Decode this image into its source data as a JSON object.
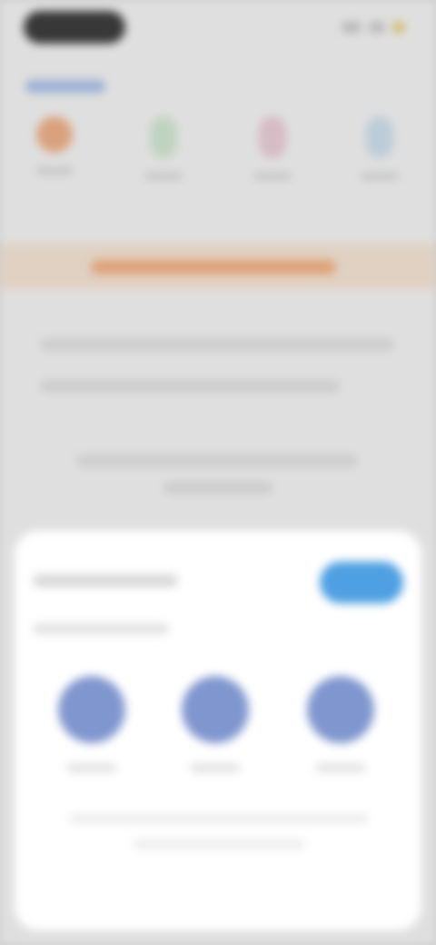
{
  "colors": {
    "background": "#e9e9e9",
    "sheet_background": "#ffffff",
    "accent_button": "#4fa0e2",
    "share_icon": "#8096cf",
    "promo_band": "#ead9c9",
    "promo_accent": "#e8a77a",
    "status_pill": "#333333"
  },
  "status_bar": {
    "icons": [
      "signal-icon",
      "wifi-icon",
      "battery-icon"
    ]
  },
  "categories": [
    {
      "icon": "category-icon-orange"
    },
    {
      "icon": "category-icon-green"
    },
    {
      "icon": "category-icon-pink"
    },
    {
      "icon": "category-icon-blue"
    }
  ],
  "sheet": {
    "title": "",
    "subtitle": "",
    "action_button_label": "",
    "targets": [
      {
        "icon": "share-target-icon",
        "label": ""
      },
      {
        "icon": "share-target-icon",
        "label": ""
      },
      {
        "icon": "share-target-icon",
        "label": ""
      }
    ],
    "footer_text": ""
  }
}
